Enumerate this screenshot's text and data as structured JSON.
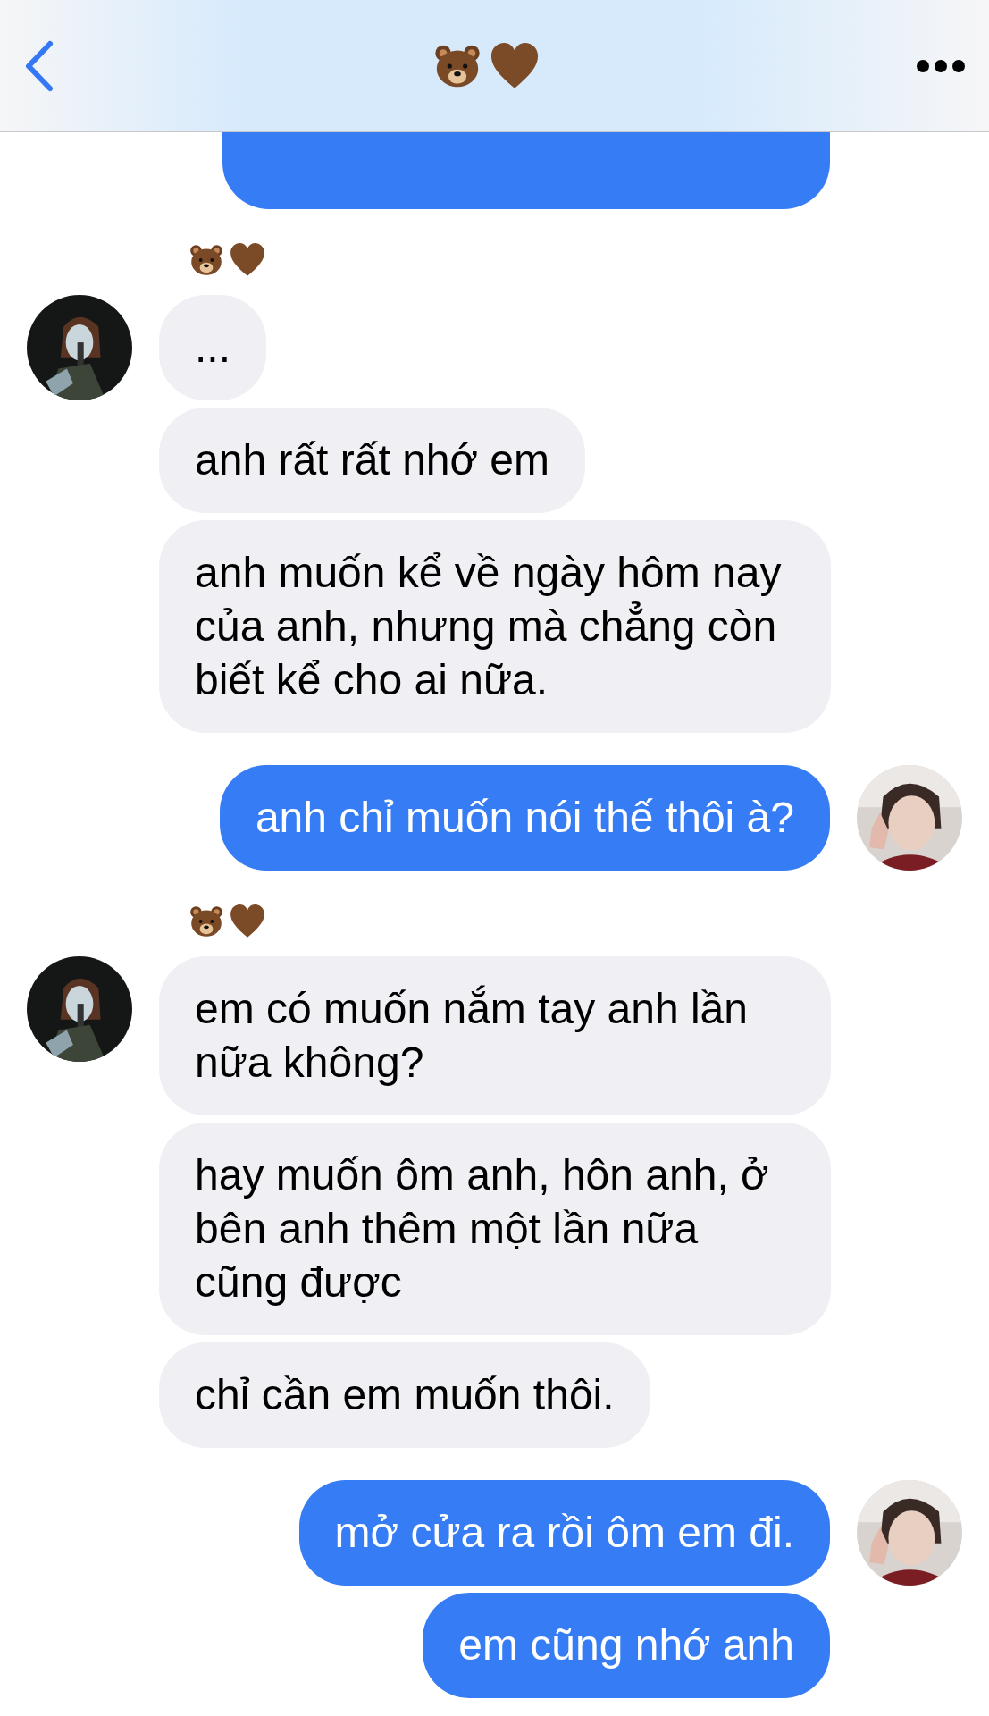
{
  "messages": [
    {
      "kind": "cut_off"
    },
    {
      "kind": "incoming",
      "bubbles": [
        "...",
        "anh rất rất nhớ em",
        "anh muốn kể về ngày hôm nay của anh, nhưng mà chẳng còn biết kể cho ai nữa."
      ]
    },
    {
      "kind": "outgoing",
      "bubbles": [
        "anh chỉ muốn nói thế thôi à?"
      ]
    },
    {
      "kind": "incoming",
      "bubbles": [
        "em có muốn nắm tay anh lần nữa không?",
        "hay muốn ôm anh, hôn anh, ở bên anh thêm một lần nữa cũng được",
        "chỉ cần em muốn thôi."
      ]
    },
    {
      "kind": "outgoing",
      "bubbles": [
        "mở cửa ra rồi ôm em đi.",
        "em cũng nhớ anh"
      ]
    }
  ]
}
